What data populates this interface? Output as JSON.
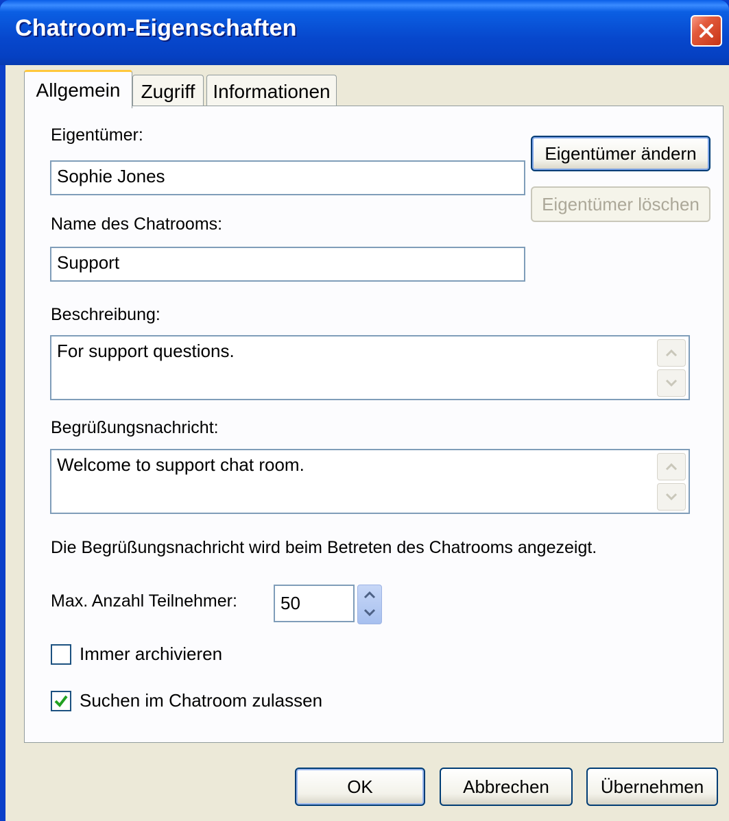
{
  "window": {
    "title": "Chatroom-Eigenschaften"
  },
  "tabs": [
    {
      "label": "Allgemein",
      "active": true
    },
    {
      "label": "Zugriff",
      "active": false
    },
    {
      "label": "Informationen",
      "active": false
    }
  ],
  "general": {
    "owner_label": "Eigentümer:",
    "owner_value": "Sophie Jones",
    "change_owner_button": "Eigentümer ändern",
    "delete_owner_button": "Eigentümer löschen",
    "room_name_label": "Name des Chatrooms:",
    "room_name_value": "Support",
    "description_label": "Beschreibung:",
    "description_value": "For support questions.",
    "welcome_label": "Begrüßungsnachricht:",
    "welcome_value": "Welcome to support chat room.",
    "welcome_hint": "Die Begrüßungsnachricht wird beim Betreten des Chatrooms angezeigt.",
    "max_participants_label": "Max. Anzahl Teilnehmer:",
    "max_participants_value": "50",
    "always_archive_label": "Immer archivieren",
    "always_archive_checked": false,
    "allow_search_label": "Suchen im Chatroom zulassen",
    "allow_search_checked": true
  },
  "footer": {
    "ok_button": "OK",
    "cancel_button": "Abbrechen",
    "apply_button": "Übernehmen"
  },
  "icons": {
    "close": "close-icon",
    "scroll_up": "chevron-up-icon",
    "scroll_down": "chevron-down-icon",
    "spin_up": "spin-up-icon",
    "spin_down": "spin-down-icon",
    "checkmark": "checkmark-icon"
  },
  "colors": {
    "titlebar": "#0747cc",
    "dialog_bg": "#ece9d8",
    "close_button": "#e25a3b",
    "checkmark": "#21a121"
  }
}
